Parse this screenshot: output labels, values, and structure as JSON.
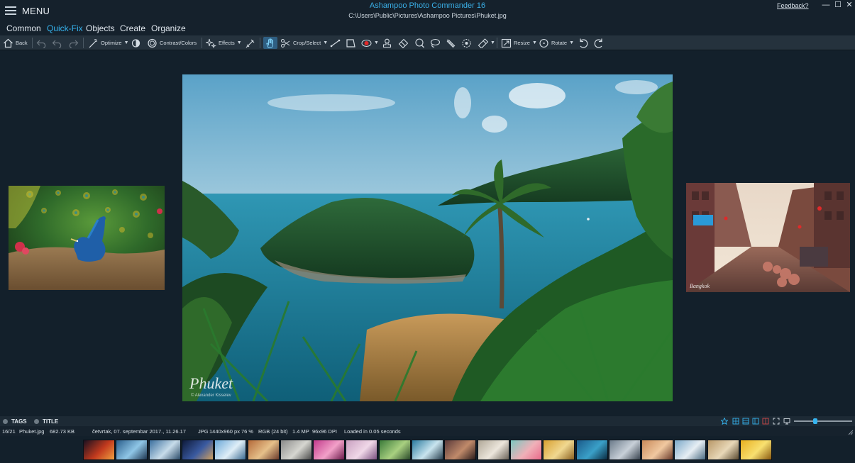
{
  "titlebar": {
    "menu_label": "MENU",
    "app_title": "Ashampoo Photo Commander 16",
    "file_path": "C:\\Users\\Public\\Pictures\\Ashampoo Pictures\\Phuket.jpg",
    "feedback_link": "Feedback?",
    "min_glyph": "—",
    "max_glyph": "☐",
    "close_glyph": "✕"
  },
  "tabs": [
    {
      "label": "Common",
      "active": false
    },
    {
      "label": "Quick-Fix",
      "active": true
    },
    {
      "label": "Objects",
      "active": false
    },
    {
      "label": "Create",
      "active": false
    },
    {
      "label": "Organize",
      "active": false
    }
  ],
  "toolbar": {
    "back_label": "Back",
    "optimize_label": "Optimize",
    "contrast_label": "Contrast/Colors",
    "effects_label": "Effects",
    "crop_label": "Crop/Select",
    "resize_label": "Resize",
    "rotate_label": "Rotate"
  },
  "tagbar": {
    "tags_label": "TAGS",
    "title_label": "TITLE",
    "zoom_level": 0.36
  },
  "infobar": {
    "position": "16/21",
    "filename": "Phuket.jpg",
    "filesize": "682.73 KB",
    "date": "četvrtak, 07. septembar 2017., 11.26.17",
    "format": "JPG",
    "dimensions": "1440x960 px",
    "zoom": "76 %",
    "color_mode": "RGB (24 bit)",
    "megapixels": "1.4 MP",
    "dpi": "96x96 DPI",
    "load_status": "Loaded in 0.05 seconds"
  },
  "viewer": {
    "watermark_title": "Phuket",
    "watermark_credit": "© Alexander Kisselev",
    "right_caption": "Bangkok"
  },
  "colors": {
    "accent": "#36b4ef",
    "background": "#13202b",
    "toolbar": "#25323d"
  },
  "filmstrip": {
    "thumbnails": [
      {
        "name": "thumb-fire",
        "colors": [
          "#1a1020",
          "#c23a1e",
          "#f0a040"
        ]
      },
      {
        "name": "thumb-bridge",
        "colors": [
          "#2a5e8c",
          "#8fc6e6",
          "#1d3550"
        ]
      },
      {
        "name": "thumb-city-river",
        "colors": [
          "#3b6f9e",
          "#c7dcea",
          "#2a4a68"
        ]
      },
      {
        "name": "thumb-night-city",
        "colors": [
          "#0e1a3a",
          "#3a5aa0",
          "#d0a060"
        ]
      },
      {
        "name": "thumb-skyline",
        "colors": [
          "#6aa8d8",
          "#dfeef7",
          "#3a6a90"
        ]
      },
      {
        "name": "thumb-street",
        "colors": [
          "#b46a3a",
          "#e6c08a",
          "#6a3a2a"
        ]
      },
      {
        "name": "thumb-animal",
        "colors": [
          "#8a8a8a",
          "#d6d6d0",
          "#4a4a4a"
        ]
      },
      {
        "name": "thumb-flowers",
        "colors": [
          "#c23a8c",
          "#f2a0c8",
          "#6a1a4a"
        ]
      },
      {
        "name": "thumb-sweets",
        "colors": [
          "#c9a0c0",
          "#f0d8e8",
          "#7a5080"
        ]
      },
      {
        "name": "thumb-garden",
        "colors": [
          "#3a7a3a",
          "#a8d080",
          "#2a4a2a"
        ]
      },
      {
        "name": "thumb-magnifier",
        "colors": [
          "#2a7aa0",
          "#c8e4ee",
          "#2a4050"
        ]
      },
      {
        "name": "thumb-interior",
        "colors": [
          "#5a3a3a",
          "#c08a6a",
          "#2a1a1a"
        ]
      },
      {
        "name": "thumb-dog",
        "colors": [
          "#b0a898",
          "#ece6dc",
          "#6a6258"
        ]
      },
      {
        "name": "thumb-macarons",
        "colors": [
          "#7ac8c0",
          "#f0b0b8",
          "#e86a8a"
        ]
      },
      {
        "name": "thumb-pasta",
        "colors": [
          "#d8a030",
          "#f0d890",
          "#8a6020"
        ]
      },
      {
        "name": "thumb-sea",
        "colors": [
          "#1a5a8a",
          "#3aa0c8",
          "#0a2a40"
        ]
      },
      {
        "name": "thumb-statue",
        "colors": [
          "#6a7a8a",
          "#c8d0d8",
          "#3a4450"
        ]
      },
      {
        "name": "thumb-bangkok",
        "colors": [
          "#c88a5a",
          "#f0c8a0",
          "#6a3a2a"
        ]
      },
      {
        "name": "thumb-harbor",
        "colors": [
          "#7aa8c8",
          "#e6eef4",
          "#4a6a80"
        ]
      },
      {
        "name": "thumb-kitten",
        "colors": [
          "#b89868",
          "#e8d8b8",
          "#5a4a30"
        ]
      },
      {
        "name": "thumb-lemons",
        "colors": [
          "#e8b020",
          "#f8e070",
          "#8a5a10"
        ]
      }
    ]
  }
}
